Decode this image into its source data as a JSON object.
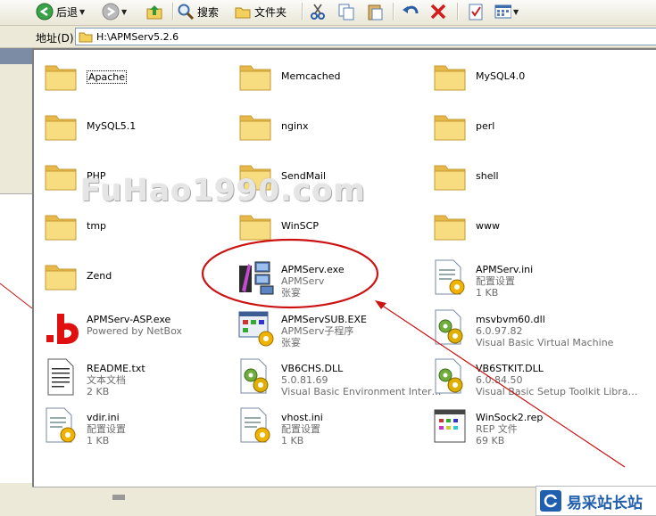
{
  "toolbar": {
    "back_label": "后退",
    "search_label": "搜索",
    "folders_label": "文件夹"
  },
  "address": {
    "label": "地址(D)",
    "path": "H:\\APMServ5.2.6"
  },
  "watermark": "FuHao1990.com",
  "logo_text": "易采站长站",
  "colors": {
    "folder": "#f5d778",
    "annotation_red": "#cc1111",
    "selection_blue": "#316ac5"
  },
  "files": [
    {
      "name": "Apache",
      "icon": "folder-icon"
    },
    {
      "name": "Memcached",
      "icon": "folder-icon"
    },
    {
      "name": "MySQL4.0",
      "icon": "folder-icon"
    },
    {
      "name": "MySQL5.1",
      "icon": "folder-icon"
    },
    {
      "name": "nginx",
      "icon": "folder-icon"
    },
    {
      "name": "perl",
      "icon": "folder-icon"
    },
    {
      "name": "PHP",
      "icon": "folder-icon"
    },
    {
      "name": "SendMail",
      "icon": "folder-icon"
    },
    {
      "name": "shell",
      "icon": "folder-icon"
    },
    {
      "name": "tmp",
      "icon": "folder-icon"
    },
    {
      "name": "WinSCP",
      "icon": "folder-icon"
    },
    {
      "name": "www",
      "icon": "folder-icon"
    },
    {
      "name": "Zend",
      "icon": "folder-icon"
    },
    {
      "name": "APMServ.exe",
      "line2": "APMServ",
      "line3": "张宴",
      "icon": "apmserv-exe-icon"
    },
    {
      "name": "APMServ.ini",
      "line2": "配置设置",
      "line3": "1 KB",
      "icon": "ini-file-icon"
    },
    {
      "name": "APMServ-ASP.exe",
      "line2": "Powered by NetBox",
      "icon": "netbox-b-icon"
    },
    {
      "name": "APMServSUB.EXE",
      "line2": "APMServ子程序",
      "line3": "张宴",
      "icon": "apmserv-sub-icon"
    },
    {
      "name": "msvbvm60.dll",
      "line2": "6.0.97.82",
      "line3": "Visual Basic Virtual Machine",
      "icon": "dll-file-icon"
    },
    {
      "name": "README.txt",
      "line2": "文本文档",
      "line3": "2 KB",
      "icon": "txt-file-icon"
    },
    {
      "name": "VB6CHS.DLL",
      "line2": "5.0.81.69",
      "line3": "Visual Basic Environment Inter…",
      "icon": "dll-file-icon"
    },
    {
      "name": "VB6STKIT.DLL",
      "line2": "6.0.84.50",
      "line3": "Visual Basic Setup Toolkit Libra…",
      "icon": "dll-file-icon"
    },
    {
      "name": "vdir.ini",
      "line2": "配置设置",
      "line3": "1 KB",
      "icon": "ini-file-icon"
    },
    {
      "name": "vhost.ini",
      "line2": "配置设置",
      "line3": "1 KB",
      "icon": "ini-file-icon"
    },
    {
      "name": "WinSock2.rep",
      "line2": "REP 文件",
      "line3": "69 KB",
      "icon": "rep-file-icon"
    }
  ]
}
